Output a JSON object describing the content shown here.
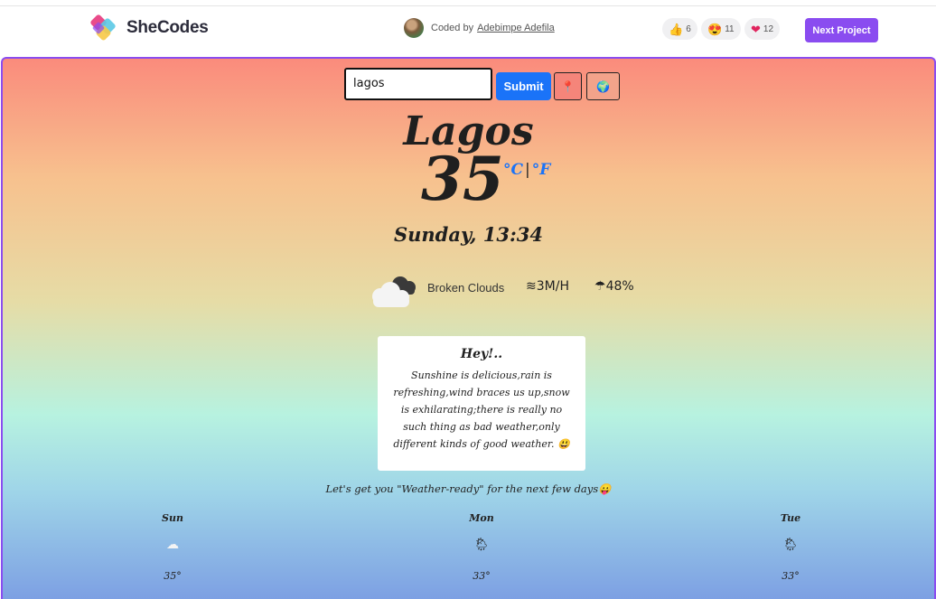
{
  "header": {
    "brand": "SheCodes",
    "coded_by_label": "Coded by",
    "coder_name": "Adebimpe Adefila",
    "reactions": [
      {
        "icon": "thumbs-up",
        "emoji": "👍",
        "count": "6"
      },
      {
        "icon": "heart-eyes",
        "emoji": "😍",
        "count": "11"
      },
      {
        "icon": "heart",
        "emoji": "❤",
        "count": "12"
      }
    ],
    "next_button": "Next Project",
    "accent_color": "#8a4cf0"
  },
  "search": {
    "value": "lagos",
    "submit_label": "Submit",
    "pin_icon": "📍",
    "globe_icon": "🌍"
  },
  "weather": {
    "city": "Lagos",
    "temperature": "35",
    "unit_c": "°C",
    "unit_separator": "|",
    "unit_f": "°F",
    "datetime": "Sunday, 13:34",
    "description": "Broken Clouds",
    "wind": "3M/H",
    "humidity": "48%",
    "wind_icon": "wind-icon",
    "humidity_icon": "umbrella-icon"
  },
  "quote": {
    "title": "Hey!..",
    "text": "Sunshine is delicious,rain is refreshing,wind braces us up,snow is exhilarating;there is really no such thing as bad weather,only different kinds of good weather. 😃"
  },
  "tagline": "Let's get you \"Weather-ready\" for the next few days😛",
  "forecast": [
    {
      "day": "Sun",
      "icon": "☁",
      "temp": "35°"
    },
    {
      "day": "Mon",
      "icon": "🌦",
      "temp": "33°"
    },
    {
      "day": "Tue",
      "icon": "🌦",
      "temp": "33°"
    }
  ]
}
